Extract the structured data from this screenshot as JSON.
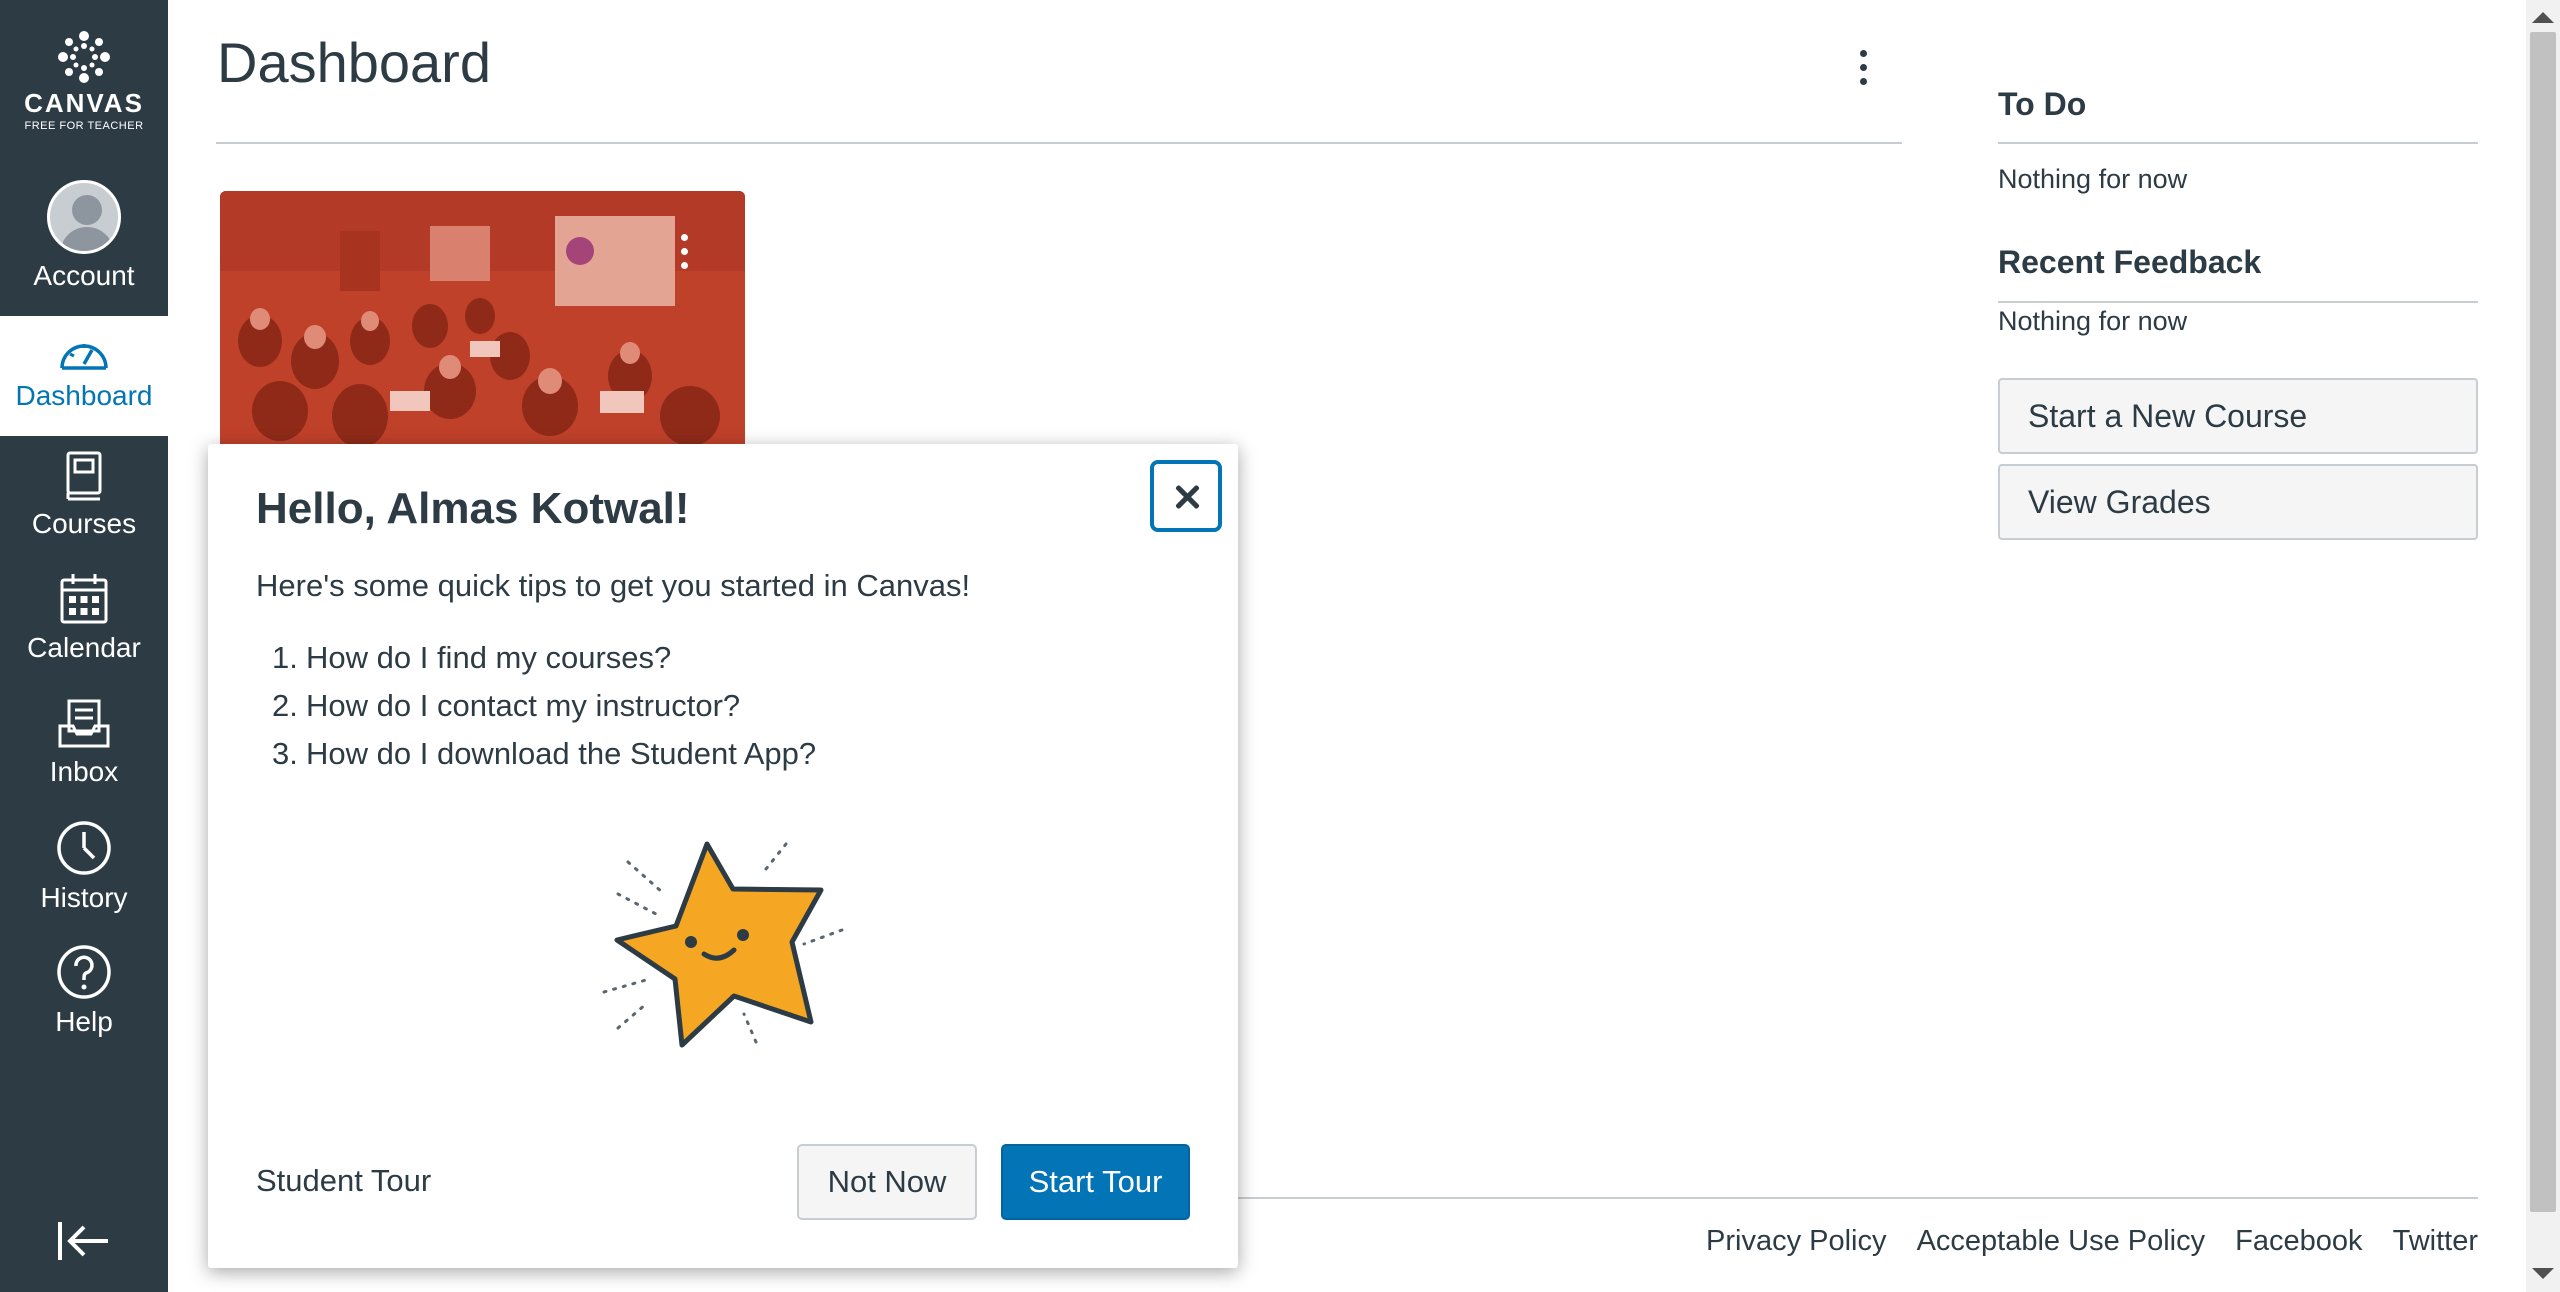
{
  "app": {
    "brand": "CANVAS",
    "brand_sub": "FREE FOR TEACHER",
    "accent_color": "#0374b5",
    "nav_bg_color": "#2d3b45"
  },
  "nav": {
    "items": [
      {
        "label": "Account",
        "icon": "avatar-icon"
      },
      {
        "label": "Dashboard",
        "icon": "dashboard-icon",
        "active": true
      },
      {
        "label": "Courses",
        "icon": "courses-icon"
      },
      {
        "label": "Calendar",
        "icon": "calendar-icon"
      },
      {
        "label": "Inbox",
        "icon": "inbox-icon"
      },
      {
        "label": "History",
        "icon": "history-icon"
      },
      {
        "label": "Help",
        "icon": "help-icon"
      }
    ],
    "collapse_icon": "collapse-arrow-icon"
  },
  "main": {
    "title": "Dashboard",
    "card": {
      "image": "classroom-photo",
      "overlay_color": "#c8442e"
    }
  },
  "sidebar": {
    "todo_title": "To Do",
    "todo_empty": "Nothing for now",
    "feedback_title": "Recent Feedback",
    "feedback_empty": "Nothing for now",
    "start_course_label": "Start a New Course",
    "view_grades_label": "View Grades"
  },
  "footer": {
    "links": [
      "Privacy Policy",
      "Acceptable Use Policy",
      "Facebook",
      "Twitter"
    ]
  },
  "tour": {
    "title": "Hello, Almas Kotwal!",
    "intro": "Here's some quick tips to get you started in Canvas!",
    "tips": [
      {
        "num": "1.",
        "text": "How do I find my courses?"
      },
      {
        "num": "2.",
        "text": "How do I contact my instructor?"
      },
      {
        "num": "3.",
        "text": "How do I download the Student App?"
      }
    ],
    "footer_label": "Student Tour",
    "not_now_label": "Not Now",
    "start_label": "Start Tour",
    "illustration": "smiling-star-icon"
  }
}
